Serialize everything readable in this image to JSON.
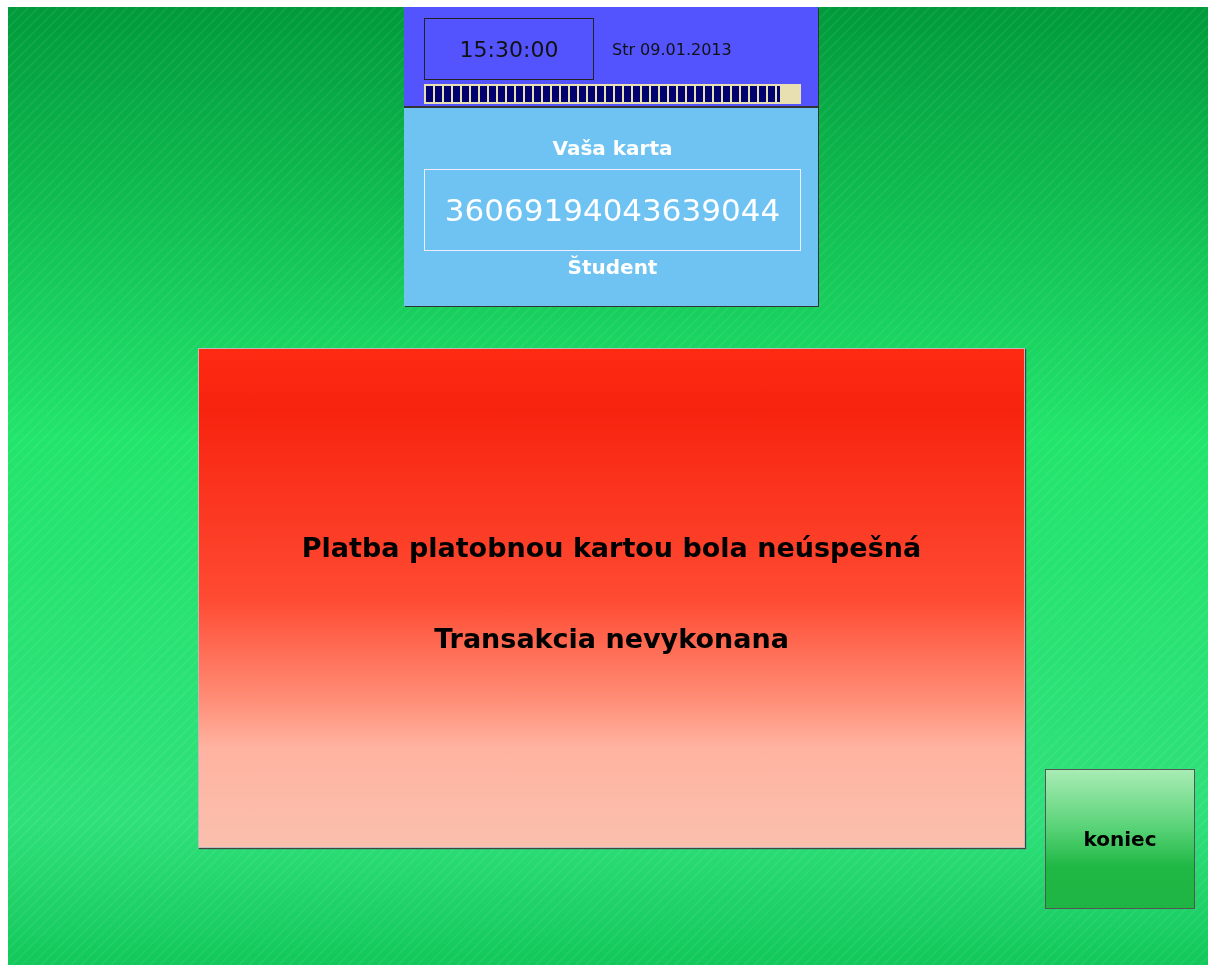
{
  "clock": {
    "time": "15:30:00",
    "date": "Str 09.01.2013",
    "progress": {
      "level": 0.95
    }
  },
  "card": {
    "title": "Vaša karta",
    "number": "36069194043639044",
    "type": "Študent"
  },
  "message": {
    "lines": [
      "Platba platobnou kartou bola neúspešná",
      "Transakcia nevykonana"
    ]
  },
  "buttons": [
    "koniec"
  ]
}
